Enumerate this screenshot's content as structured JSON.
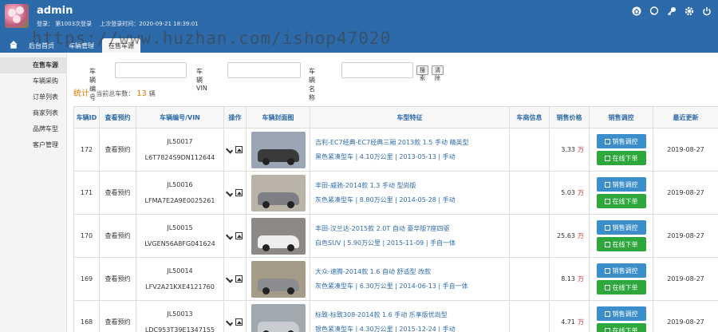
{
  "header": {
    "username": "admin",
    "login_count": "登录：  第1003次登录",
    "last_login": "上次登录时间：2020-09-21 18:39:01",
    "icons": [
      "home-icon",
      "chat-icon",
      "key-icon",
      "gear-icon",
      "power-icon"
    ],
    "watermark": "https://www.huzhan.com/ishop47020"
  },
  "nav": {
    "tabs": [
      {
        "label": "后台首页"
      },
      {
        "label": "车辆管理"
      },
      {
        "label": "在售车源",
        "active": true
      }
    ]
  },
  "sidebar": {
    "items": [
      {
        "label": "在售车源",
        "active": true
      },
      {
        "label": "车辆采购"
      },
      {
        "label": "订单列表"
      },
      {
        "label": "商家列表"
      },
      {
        "label": "品牌车型"
      },
      {
        "label": "客户管理"
      }
    ]
  },
  "search": {
    "vehicle_no_label": "车辆编号",
    "vin_label": "车辆VIN",
    "name_label": "车辆名称",
    "search_button": "搜索",
    "reset_button": "清除"
  },
  "stats": {
    "title": "统计",
    "label": "- 当前总车数：",
    "count": "13",
    "unit": "辆"
  },
  "table": {
    "columns": [
      "车辆ID",
      "查看预约",
      "车辆编号/VIN",
      "操作",
      "车辆封面图",
      "车型特征",
      "车商信息",
      "销售价格",
      "销售调控",
      "最近更新"
    ],
    "price_unit": "万",
    "btn_sale": "销售调控",
    "btn_online": "在线下单",
    "rows": [
      {
        "id": "172",
        "booking": "查看预约",
        "no": "JL50017",
        "vin": "L6T7824S9DN112644",
        "title": "吉利-EC7经典-EC7经典三厢 2013款 1.5 手动 精英型",
        "color": "黑色紧凑型车",
        "mileage": "4.10万公里",
        "date": "2013-05-13",
        "gear": "手动",
        "price": "3.33",
        "updated": "2019-08-27",
        "car_color": "#3a3a3a",
        "bg": "#9aa6b3"
      },
      {
        "id": "171",
        "booking": "查看预约",
        "no": "JL50016",
        "vin": "LFMA7E2A9E0025261",
        "title": "丰田-威驰-2014款 1.3 手动 型尚版",
        "color": "灰色紧凑型车",
        "mileage": "8.80万公里",
        "date": "2014-05-28",
        "gear": "手动",
        "price": "5.03",
        "updated": "2019-08-27",
        "car_color": "#7d7f84",
        "bg": "#b9b3a8"
      },
      {
        "id": "170",
        "booking": "查看预约",
        "no": "JL50015",
        "vin": "LVGEN56A8FG041624",
        "title": "丰田-汉兰达-2015款 2.0T 自动 豪华版7座四驱",
        "color": "白色SUV",
        "mileage": "5.90万公里",
        "date": "2015-11-09",
        "gear": "手自一体",
        "price": "25.63",
        "updated": "2019-08-27",
        "car_color": "#eeeeee",
        "bg": "#8d8a86"
      },
      {
        "id": "169",
        "booking": "查看预约",
        "no": "JL50014",
        "vin": "LFV2A21KXE4121760",
        "title": "大众-速腾-2014款 1.6 自动 舒适型 改款",
        "color": "灰色紧凑型车",
        "mileage": "6.30万公里",
        "date": "2014-06-13",
        "gear": "手自一体",
        "price": "8.13",
        "updated": "2019-08-27",
        "car_color": "#8a8c90",
        "bg": "#a69a88"
      },
      {
        "id": "168",
        "booking": "查看预约",
        "no": "JL50013",
        "vin": "LDC953T39E1347155",
        "title": "标致-标致308-2014款 1.6 手动 乐享版优尚型",
        "color": "银色紧凑型车",
        "mileage": "4.30万公里",
        "date": "2015-12-24",
        "gear": "手动",
        "price": "4.71",
        "updated": "2019-08-27",
        "car_color": "#c9ccd0",
        "bg": "#a0a8b0"
      }
    ]
  },
  "colors": {
    "header_bg": "#2d6aa9",
    "accent": "#2d6aa9",
    "highlight_orange": "#e07b00",
    "price_unit_red": "#dd3333",
    "button_blue": "#3b8ec9",
    "button_green": "#2ea83c"
  }
}
